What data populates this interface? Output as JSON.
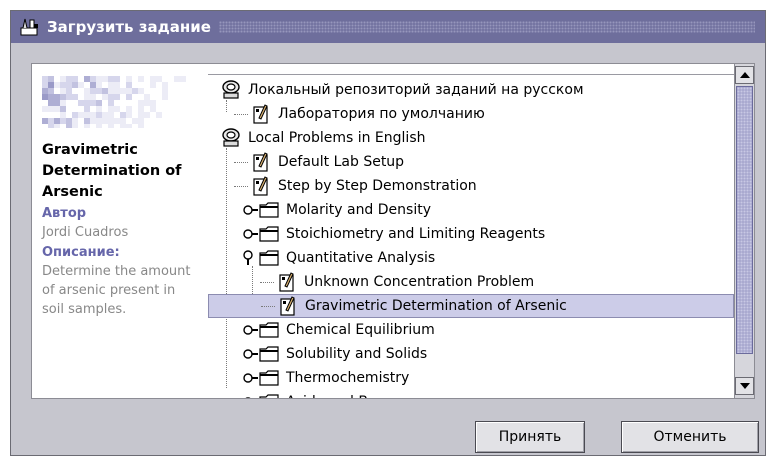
{
  "dialog": {
    "title": "Загрузить задание"
  },
  "info": {
    "title": "Gravimetric Determination of Arsenic",
    "author_label": "Автор",
    "author": "Jordi Cuadros",
    "description_label": "Описание:",
    "description": "Determine the amount of arsenic present in soil samples."
  },
  "tree": {
    "items": [
      {
        "label": "Локальный репозиторий заданий на русском",
        "type": "repository",
        "level": 0
      },
      {
        "label": "Лаборатория по умолчанию",
        "type": "lab",
        "level": 1
      },
      {
        "label": "Local Problems in English",
        "type": "repository",
        "level": 0
      },
      {
        "label": "Default Lab Setup",
        "type": "lab",
        "level": 1
      },
      {
        "label": "Step by Step Demonstration",
        "type": "lab",
        "level": 1
      },
      {
        "label": "Molarity and Density",
        "type": "folder",
        "level": 1,
        "expanded": false
      },
      {
        "label": "Stoichiometry and Limiting Reagents",
        "type": "folder",
        "level": 1,
        "expanded": false
      },
      {
        "label": "Quantitative Analysis",
        "type": "folder",
        "level": 1,
        "expanded": true
      },
      {
        "label": "Unknown Concentration Problem",
        "type": "lab",
        "level": 2
      },
      {
        "label": "Gravimetric Determination of Arsenic",
        "type": "lab",
        "level": 2,
        "selected": true
      },
      {
        "label": "Chemical Equilibrium",
        "type": "folder",
        "level": 1,
        "expanded": false
      },
      {
        "label": "Solubility and Solids",
        "type": "folder",
        "level": 1,
        "expanded": false
      },
      {
        "label": "Thermochemistry",
        "type": "folder",
        "level": 1,
        "expanded": false
      },
      {
        "label": "Acids and Bases",
        "type": "folder",
        "level": 1,
        "expanded": false
      }
    ]
  },
  "buttons": {
    "accept": "Принять",
    "cancel": "Отменить"
  },
  "colors": {
    "titlebar": "#6e6e9c",
    "selection": "#cccce8",
    "scroll_thumb": "#a4a4cc",
    "accent_label": "#6666aa"
  },
  "icons": {
    "title": "lab-tools-icon",
    "repository": "database-icon",
    "lab": "lab-document-icon",
    "folder": "folder-icon",
    "toggle": "tree-toggle-icon"
  }
}
